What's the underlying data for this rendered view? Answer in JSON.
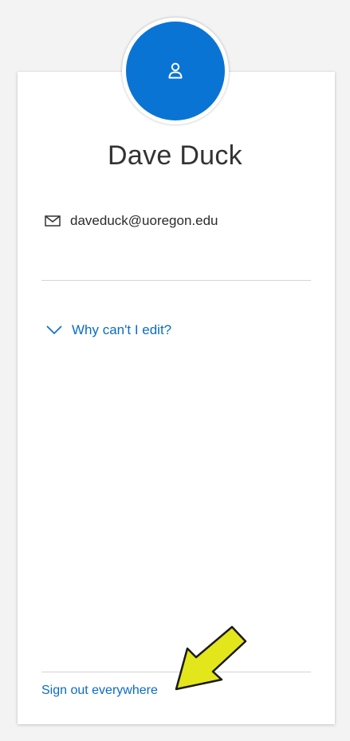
{
  "profile": {
    "name": "Dave Duck",
    "email": "daveduck@uoregon.edu"
  },
  "edit_help": {
    "label": "Why can't I edit?"
  },
  "footer": {
    "signout_label": "Sign out everywhere"
  },
  "colors": {
    "accent": "#0a74d4",
    "link": "#0a6cc2",
    "arrow_fill": "#e3e61a"
  },
  "icons": {
    "avatar": "person-icon",
    "email": "envelope-icon",
    "toggle": "chevron-down-icon",
    "annotation": "arrow-annotation"
  }
}
